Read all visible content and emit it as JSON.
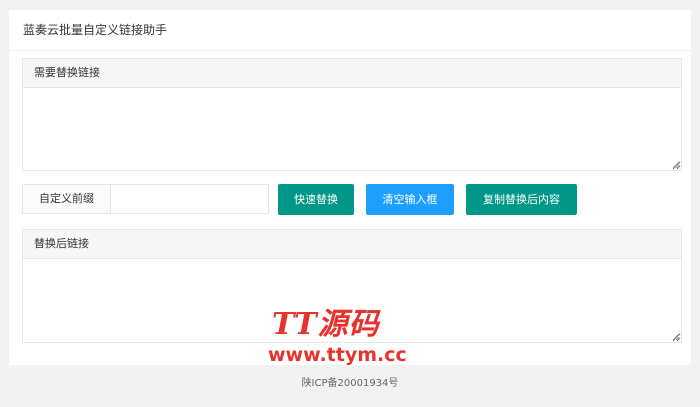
{
  "app": {
    "title": "蓝奏云批量自定义链接助手"
  },
  "source_panel": {
    "label": "需要替换链接",
    "value": "",
    "placeholder": ""
  },
  "prefix": {
    "label": "自定义前缀",
    "value": "",
    "placeholder": ""
  },
  "buttons": {
    "quick_replace": "快速替换",
    "clear_input": "清空输入框",
    "copy_result": "复制替换后内容"
  },
  "result_panel": {
    "label": "替换后链接",
    "value": "",
    "placeholder": ""
  },
  "footer": {
    "icp": "陕ICP备20001934号"
  },
  "watermark": {
    "brand": "TT源码",
    "url": "www.ttym.cc"
  },
  "colors": {
    "primary_green": "#009688",
    "normal_blue": "#1e9fff",
    "watermark_red": "#e8332c"
  }
}
